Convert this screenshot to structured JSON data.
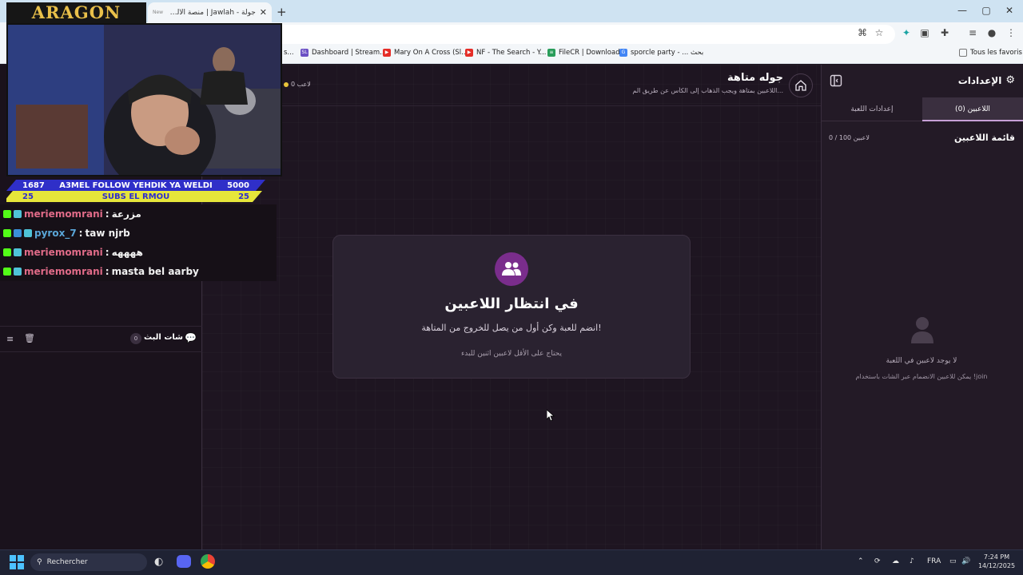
{
  "browser": {
    "tab_title": "جولة - Jawlah | منصة الألعاب التفاعلية",
    "tab_favicon": "New",
    "new_tab": "+",
    "bookmarks": [
      {
        "label": "Dashboard | Stream...",
        "icon": "SL",
        "color": "#6a4fc4"
      },
      {
        "label": "Mary On A Cross (Sl...",
        "icon": "▶",
        "color": "#e52d27"
      },
      {
        "label": "NF - The Search - Y...",
        "icon": "▶",
        "color": "#e52d27"
      },
      {
        "label": "FileCR | Download",
        "icon": "≡",
        "color": "#2a9d5a"
      },
      {
        "label": "sporcle party - ... بحث",
        "icon": "G",
        "color": "#4285f4"
      }
    ],
    "favorites_label": "Tous les favoris",
    "bookmark_fragment": "s..."
  },
  "game": {
    "title": "جوله متاهة",
    "description": "اللاعبين بمتاهة ويجب الذهاب إلى الكأس عن طريق الم...",
    "players_indicator": "0 لاعب",
    "status_title": "في انتظار اللاعبين",
    "status_sub": "انضم للعبة وكن أول من يصل للخروج من المتاهة!",
    "status_note": "يحتاج على الأقل لاعبين اثنين للبدء"
  },
  "settings_panel": {
    "title": "الإعدادات",
    "tab_players": "اللاعبين (0)",
    "tab_game_settings": "إعدادات اللعبة",
    "players_list_title": "قائمة اللاعبين",
    "players_count": "0 / 100 لاعبين",
    "empty_title": "لا يوجد لاعبين في اللعبة",
    "empty_sub": "يمكن للاعبين الانضمام عبر الشات باستخدام !join"
  },
  "stream_chat": {
    "title": "شات البث",
    "count": "0"
  },
  "overlay": {
    "logo": "ARAGON",
    "ticker_left_top": "1687",
    "ticker_text_top": "A3MEL FOLLOW YEHDIK YA WELDI",
    "ticker_right_top": "5000",
    "ticker_left_bottom": "25",
    "ticker_text_bottom": "SUBS EL RMOU",
    "ticker_right_bottom": "25",
    "chat": [
      {
        "user": "meriemomrani",
        "message": "مزرعة",
        "color": "pink"
      },
      {
        "user": "pyrox_7",
        "message": "taw njrb",
        "color": "blue"
      },
      {
        "user": "meriemomrani",
        "message": "ههههه",
        "color": "pink"
      },
      {
        "user": "meriemomrani",
        "message": "masta bel aarby",
        "color": "pink"
      }
    ]
  },
  "taskbar": {
    "search_placeholder": "Rechercher",
    "language": "FRA",
    "time": "7:24 PM",
    "date": "14/12/2025"
  }
}
